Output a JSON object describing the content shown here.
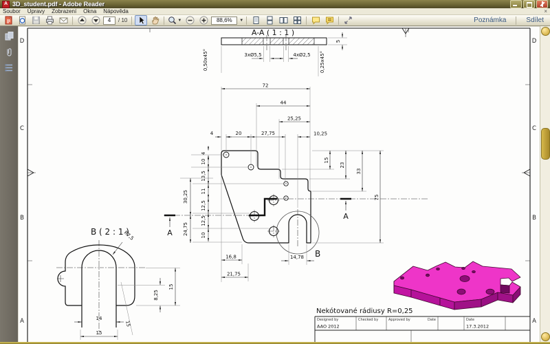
{
  "window": {
    "title": "3D_student.pdf - Adobe Reader",
    "app_initial": "A"
  },
  "menu": {
    "items": [
      "Soubor",
      "Úpravy",
      "Zobrazení",
      "Okna",
      "Nápověda"
    ],
    "close_glyph": "×"
  },
  "toolbar": {
    "page_current": "4",
    "page_divider": "/ 10",
    "zoom_value": "88,6%",
    "note_button": "Poznámka",
    "share_button": "Sdílet",
    "icons": [
      "create-pdf-icon",
      "collaborate-icon",
      "save-icon",
      "print-icon",
      "email-icon",
      "page-up-icon",
      "page-down-icon",
      "select-tool-icon",
      "hand-tool-icon",
      "zoom-loupe-icon",
      "zoom-out-icon",
      "zoom-in-icon",
      "single-page-icon",
      "continuous-icon",
      "two-up-icon",
      "four-up-icon",
      "comment-bubble-icon",
      "markup-bubble-icon",
      "expand-icon"
    ]
  },
  "sidebar": {
    "icons": [
      "page-thumbnails-icon",
      "attachments-icon",
      "bookmarks-icon"
    ]
  },
  "drawing": {
    "section_view": {
      "title": "A-A ( 1 : 1 )",
      "dim_holes_large": "3xØ5,5",
      "dim_holes_small": "4xØ2,5",
      "dim_thickness": "5",
      "dim_chamfer_left": "0,50x45°",
      "dim_chamfer_right": "0,25x45°"
    },
    "main_view": {
      "dim_width_total": "72",
      "dim_width_44": "44",
      "dim_width_2525": "25,25",
      "dim_4": "4",
      "dim_20": "20",
      "dim_2775": "27,75",
      "dim_1025": "10,25",
      "dim_right_15": "15",
      "dim_right_23": "23",
      "dim_right_33": "33",
      "dim_right_75": "75",
      "left_chain": [
        "4",
        "10",
        "13,5",
        "11",
        "12,5",
        "12,5",
        "10"
      ],
      "dim_3025": "30,25",
      "dim_2475": "24,75",
      "dim_168": "16,8",
      "dim_2175": "21,75",
      "dim_1478": "14,78",
      "section_label_left": "A",
      "section_label_right": "A",
      "detail_label": "B"
    },
    "detail_view": {
      "title": "B ( 2 : 1 )",
      "dim_radius": "R7,5",
      "dim_14": "14",
      "dim_15_outer": "15",
      "dim_15_side": "15",
      "dim_825": "8,25",
      "dim_15_height": "15"
    },
    "note": "Nekótované rádiusy R=0,25",
    "title_block": {
      "designed_label": "Designed by",
      "designed_value": "AAO 2012",
      "checked_label": "Checked by",
      "approved_label": "Approved by",
      "date_label": "Date",
      "date2_label": "Date",
      "date_value": "17.3.2012"
    },
    "zones": {
      "left": [
        "D",
        "C",
        "B",
        "A"
      ],
      "right": [
        "D",
        "C",
        "B",
        "A"
      ]
    },
    "colors": {
      "part_top": "#ee35c8",
      "part_side": "#b5129a",
      "part_side_dark": "#990f82"
    }
  }
}
